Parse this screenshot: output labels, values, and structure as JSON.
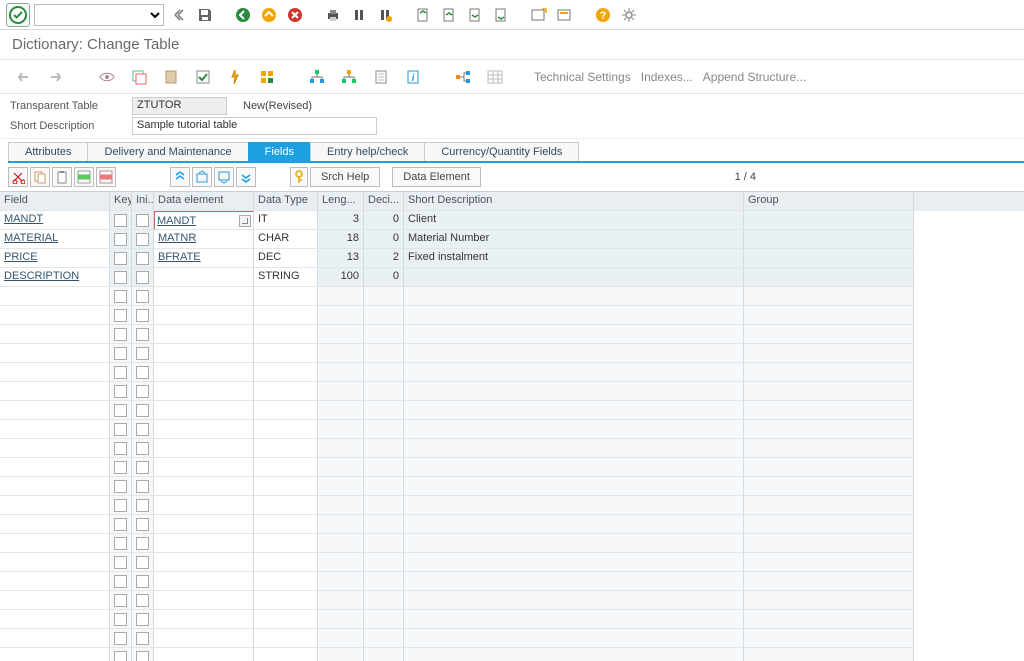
{
  "app_title": "Dictionary: Change Table",
  "form": {
    "table_label": "Transparent Table",
    "table_name": "ZTUTOR",
    "status": "New(Revised)",
    "desc_label": "Short Description",
    "desc_value": "Sample tutorial table"
  },
  "tabs": [
    {
      "label": "Attributes"
    },
    {
      "label": "Delivery and Maintenance"
    },
    {
      "label": "Fields",
      "active": true
    },
    {
      "label": "Entry help/check"
    },
    {
      "label": "Currency/Quantity Fields"
    }
  ],
  "subtoolbar": {
    "srch_help": "Srch Help",
    "data_element": "Data Element",
    "counter": "1 / 4"
  },
  "toolbar_links": {
    "tech": "Technical Settings",
    "indexes": "Indexes...",
    "append": "Append Structure..."
  },
  "columns": {
    "field": "Field",
    "key": "Key",
    "ini": "Ini...",
    "elem": "Data element",
    "type": "Data Type",
    "len": "Leng...",
    "dec": "Deci...",
    "desc": "Short Description",
    "group": "Group"
  },
  "rows": [
    {
      "field": "MANDT",
      "elem": "MANDT",
      "type": "IT",
      "len": "3",
      "dec": "0",
      "desc": "Client",
      "active": true
    },
    {
      "field": "MATERIAL",
      "elem": "MATNR",
      "type": "CHAR",
      "len": "18",
      "dec": "0",
      "desc": "Material Number"
    },
    {
      "field": "PRICE",
      "elem": "BFRATE",
      "type": "DEC",
      "len": "13",
      "dec": "2",
      "desc": "Fixed instalment"
    },
    {
      "field": "DESCRIPTION",
      "elem": "",
      "type": "STRING",
      "len": "100",
      "dec": "0",
      "desc": ""
    }
  ]
}
